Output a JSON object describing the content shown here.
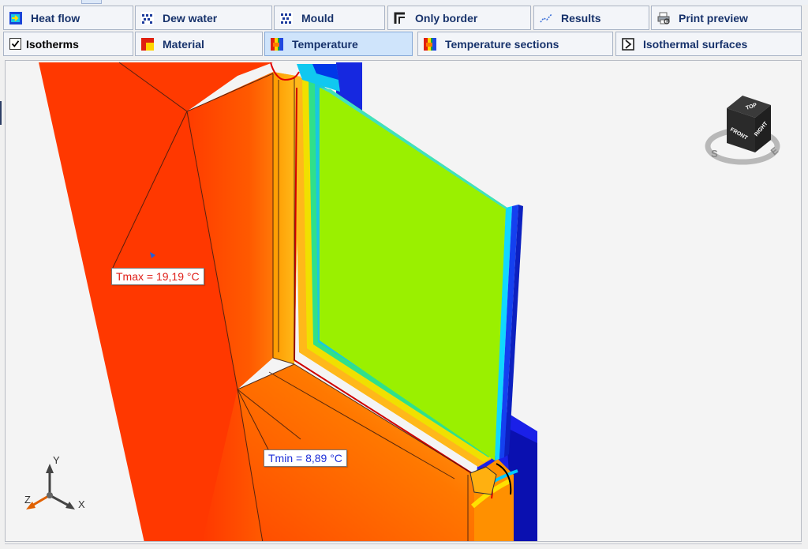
{
  "toolbar": {
    "row1": [
      {
        "label": "Heat flow",
        "icon": "heat-flow-icon"
      },
      {
        "label": "Dew water",
        "icon": "dew-water-icon"
      },
      {
        "label": "Mould",
        "icon": "mould-icon"
      },
      {
        "label": "Only border",
        "icon": "border-icon"
      },
      {
        "label": "Results",
        "icon": "results-icon"
      },
      {
        "label": "Print preview",
        "icon": "print-preview-icon"
      }
    ],
    "row2": [
      {
        "label": "Isotherms",
        "icon": "checkbox",
        "checked": true
      },
      {
        "label": "Material",
        "icon": "material-icon"
      },
      {
        "label": "Temperature",
        "icon": "temperature-icon",
        "active": true
      },
      {
        "label": "Temperature sections",
        "icon": "temperature-sections-icon"
      },
      {
        "label": "Isothermal surfaces",
        "icon": "isothermal-surfaces-icon"
      }
    ]
  },
  "viewer": {
    "tmax_label": "Tmax = 19,19 °C",
    "tmin_label": "Tmin = 8,89 °C",
    "view_cube": {
      "top": "TOP",
      "front": "FRONT",
      "right": "RIGHT",
      "compass_s": "S",
      "compass_e": "E"
    },
    "axes": {
      "x": "X",
      "y": "Y",
      "z": "Z"
    }
  },
  "colors": {
    "accent_active": "#cfe4fb",
    "button_text": "#17326b",
    "tmax_text": "#e0201a",
    "tmin_text": "#1d2fd8",
    "warm": "#ff3c00",
    "glass": "#9af000",
    "cold": "#0018e0"
  }
}
